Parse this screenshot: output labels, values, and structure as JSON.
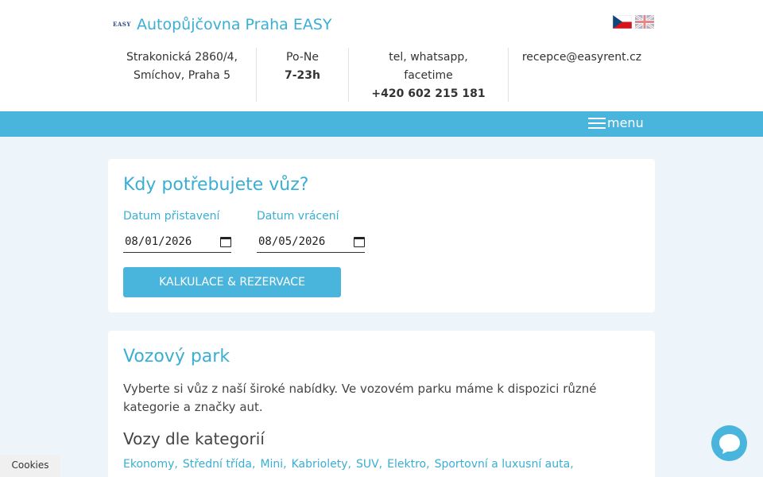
{
  "header": {
    "logo_text": "EASY",
    "title": "Autopůjčovna Praha EASY",
    "flags": [
      "cz-flag-icon",
      "gb-flag-icon"
    ]
  },
  "info": {
    "address_line1": "Strakonická 2860/4,",
    "address_line2": "Smíchov, Praha 5",
    "hours_days": "Po-Ne",
    "hours_time": "7-23h",
    "contact_line1": "tel, whatsapp,",
    "contact_line2": "facetime",
    "phone": "+420 602 215 181",
    "email": "recepce@easyrent.cz"
  },
  "nav": {
    "menu_label": "menu"
  },
  "booking": {
    "title": "Kdy potřebujete vůz?",
    "pickup_label": "Datum přistavení",
    "pickup_value": "08/01/2026",
    "return_label": "Datum vrácení",
    "return_value": "08/05/2026",
    "submit_label": "KALKULACE & REZERVACE"
  },
  "fleet": {
    "title": "Vozový park",
    "description": "Vyberte si vůz z naší široké nabídky. Ve vozovém parku máme k dispozici různé kategorie a značky aut.",
    "categories_title": "Vozy dle kategorií",
    "categories": [
      "Ekonomy,",
      "Střední třída,",
      "Mini,",
      "Kabriolety,",
      "SUV,",
      "Elektro,",
      "Sportovní a luxusní auta,"
    ]
  },
  "footer": {
    "cookies_label": "Cookies"
  },
  "colors": {
    "accent": "#49b5dc",
    "link": "#3aaed4",
    "background": "#eef5fa"
  }
}
